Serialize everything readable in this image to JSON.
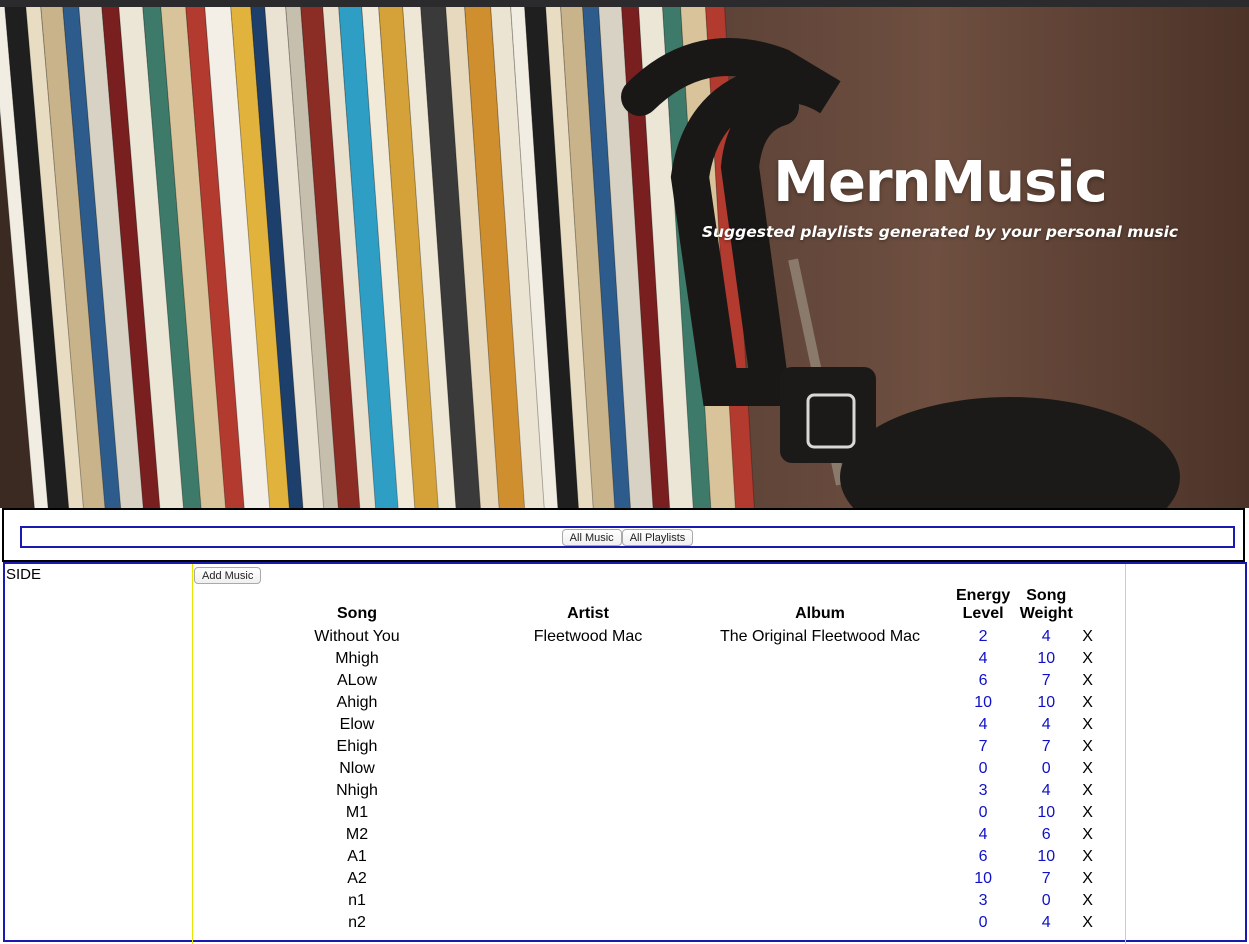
{
  "hero": {
    "title": "MernMusic",
    "subtitle": "Suggested playlists generated by your personal music"
  },
  "nav": {
    "all_music_label": "All Music",
    "all_playlists_label": "All Playlists"
  },
  "sidebar": {
    "label": "SIDE"
  },
  "main": {
    "add_music_label": "Add Music",
    "columns": {
      "song": "Song",
      "artist": "Artist",
      "album": "Album",
      "energy": "Energy Level",
      "weight": "Song Weight"
    },
    "delete_label": "X",
    "rows": [
      {
        "song": "Without You",
        "artist": "Fleetwood Mac",
        "album": "The Original Fleetwood Mac",
        "energy": "2",
        "weight": "4"
      },
      {
        "song": "Mhigh",
        "artist": "",
        "album": "",
        "energy": "4",
        "weight": "10"
      },
      {
        "song": "ALow",
        "artist": "",
        "album": "",
        "energy": "6",
        "weight": "7"
      },
      {
        "song": "Ahigh",
        "artist": "",
        "album": "",
        "energy": "10",
        "weight": "10"
      },
      {
        "song": "Elow",
        "artist": "",
        "album": "",
        "energy": "4",
        "weight": "4"
      },
      {
        "song": "Ehigh",
        "artist": "",
        "album": "",
        "energy": "7",
        "weight": "7"
      },
      {
        "song": "Nlow",
        "artist": "",
        "album": "",
        "energy": "0",
        "weight": "0"
      },
      {
        "song": "Nhigh",
        "artist": "",
        "album": "",
        "energy": "3",
        "weight": "4"
      },
      {
        "song": "M1",
        "artist": "",
        "album": "",
        "energy": "0",
        "weight": "10"
      },
      {
        "song": "M2",
        "artist": "",
        "album": "",
        "energy": "4",
        "weight": "6"
      },
      {
        "song": "A1",
        "artist": "",
        "album": "",
        "energy": "6",
        "weight": "10"
      },
      {
        "song": "A2",
        "artist": "",
        "album": "",
        "energy": "10",
        "weight": "7"
      },
      {
        "song": "n1",
        "artist": "",
        "album": "",
        "energy": "3",
        "weight": "0"
      },
      {
        "song": "n2",
        "artist": "",
        "album": "",
        "energy": "0",
        "weight": "4"
      }
    ]
  }
}
